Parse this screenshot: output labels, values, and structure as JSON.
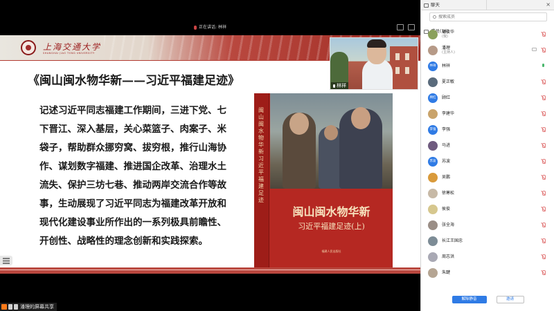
{
  "share": {
    "speaker_text": "正在讲话: 林祥",
    "screen_share_label": "潘理的屏幕共享"
  },
  "slide": {
    "university_name": "上海交通大学",
    "university_name_en": "SHANGHAI JIAO TONG UNIVERSITY",
    "title": "《闽山闽水物华新——习近平福建足迹》",
    "body_lines": [
      "记述习近平同志福建工作期间，三进下党、七",
      "下晋江、深入基层，关心菜篮子、肉案子、米",
      "袋子，帮助群众挪穷窝、拔穷根，推行山海协",
      "作、谋划数字福建、推进国企改革、治理水土",
      "流失、保护三坊七巷、推动两岸交流合作等故",
      "事，生动展现了习近平同志为福建改革开放和",
      "现代化建设事业所作出的一系列极具前瞻性、",
      "开创性、战略性的理念创新和实践探索。"
    ],
    "book": {
      "spine_text": "闽山闽水物华新 习近平福建足迹",
      "title": "闽山闽水物华新",
      "subtitle": "习近平福建足迹(上)",
      "publisher": "福建人民出版社"
    }
  },
  "camera": {
    "name": "林祥"
  },
  "panel": {
    "tab_chat": "聊天",
    "tab_members": "成员(16)",
    "close_glyph": "×",
    "search_placeholder": "搜索成员",
    "members": [
      {
        "name": "蒲俊华",
        "role": "(我)",
        "avatar_text": "",
        "avatar_color": "#8aa05c",
        "mic": "off",
        "cam": false
      },
      {
        "name": "潘理",
        "role": "(主持人)",
        "avatar_text": "",
        "avatar_color": "#b69a88",
        "mic": "off",
        "cam": true
      },
      {
        "name": "林祥",
        "role": "",
        "avatar_text": "林祥",
        "avatar_color": "#2f7be5",
        "mic": "on",
        "cam": false
      },
      {
        "name": "夏正敏",
        "role": "",
        "avatar_text": "",
        "avatar_color": "#5a6b7c",
        "mic": "off",
        "cam": false
      },
      {
        "name": "顾红",
        "role": "",
        "avatar_text": "顾红",
        "avatar_color": "#2f7be5",
        "mic": "off",
        "cam": false
      },
      {
        "name": "李建华",
        "role": "",
        "avatar_text": "",
        "avatar_color": "#c9a36b",
        "mic": "off",
        "cam": false
      },
      {
        "name": "李强",
        "role": "",
        "avatar_text": "李强",
        "avatar_color": "#2f7be5",
        "mic": "off",
        "cam": false
      },
      {
        "name": "马进",
        "role": "",
        "avatar_text": "",
        "avatar_color": "#6f5b7f",
        "mic": "off",
        "cam": false
      },
      {
        "name": "苏波",
        "role": "",
        "avatar_text": "苏波",
        "avatar_color": "#2f7be5",
        "mic": "off",
        "cam": false
      },
      {
        "name": "吴鹏",
        "role": "",
        "avatar_text": "",
        "avatar_color": "#d99a3b",
        "mic": "off",
        "cam": false
      },
      {
        "name": "徐寒松",
        "role": "",
        "avatar_text": "",
        "avatar_color": "#c7b9a6",
        "mic": "off",
        "cam": false
      },
      {
        "name": "侯俊",
        "role": "",
        "avatar_text": "",
        "avatar_color": "#d6c78e",
        "mic": "off",
        "cam": false
      },
      {
        "name": "张全海",
        "role": "",
        "avatar_text": "",
        "avatar_color": "#9a8e86",
        "mic": "off",
        "cam": false
      },
      {
        "name": "长江王国忠",
        "role": "",
        "avatar_text": "",
        "avatar_color": "#7d8c96",
        "mic": "off",
        "cam": false
      },
      {
        "name": "周志洪",
        "role": "",
        "avatar_text": "",
        "avatar_color": "#a9a9b4",
        "mic": "off",
        "cam": false
      },
      {
        "name": "朱踺",
        "role": "",
        "avatar_text": "",
        "avatar_color": "#b5a593",
        "mic": "off",
        "cam": false
      }
    ],
    "unmute_all_label": "解除静音",
    "invite_label": "邀请"
  }
}
